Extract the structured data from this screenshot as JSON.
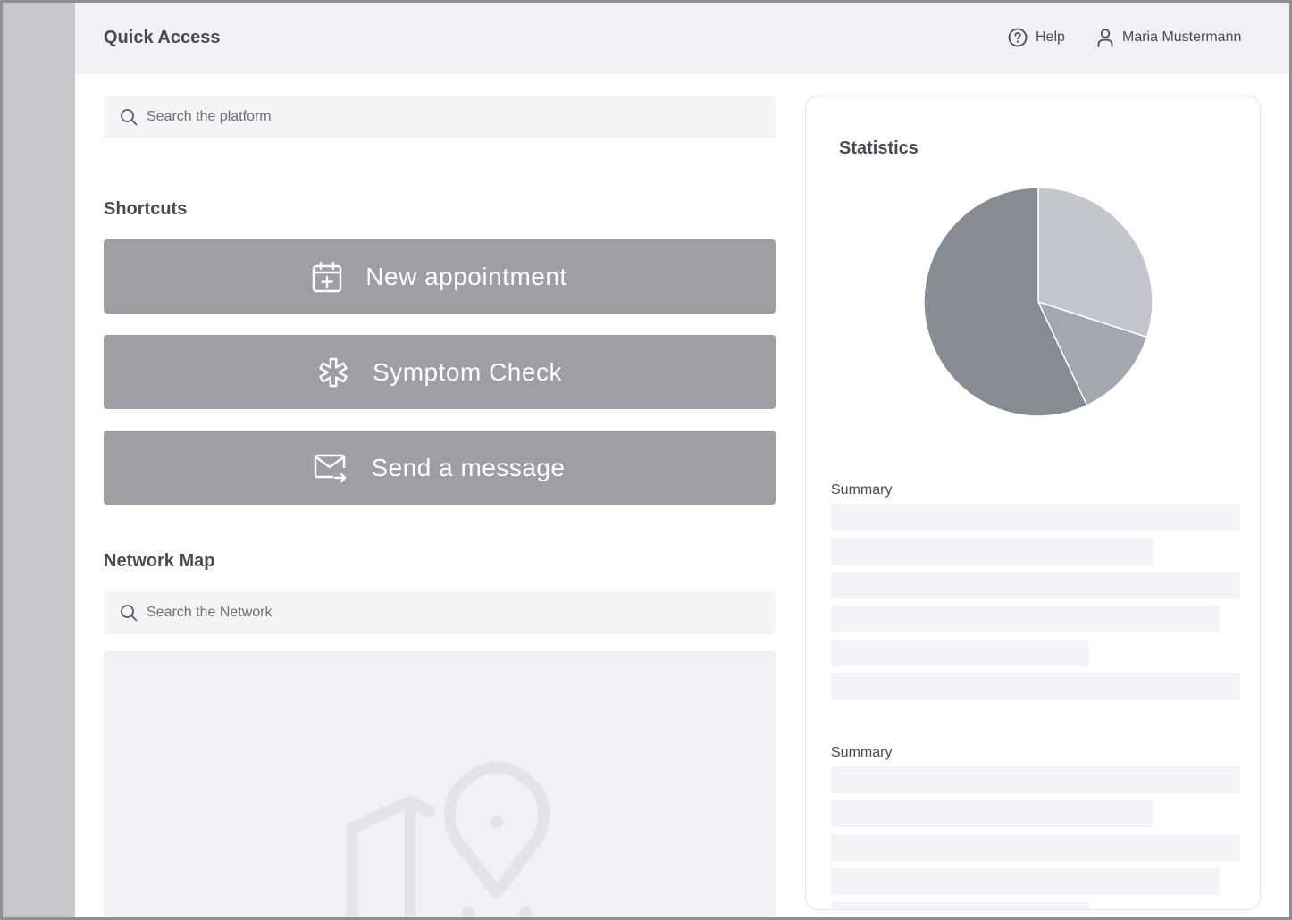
{
  "header": {
    "title": "Quick Access",
    "help_label": "Help",
    "user_name": "Maria Mustermann"
  },
  "search": {
    "placeholder": "Search the platform"
  },
  "shortcuts": {
    "title": "Shortcuts",
    "items": [
      {
        "label": "New appointment",
        "icon": "calendar-plus-icon"
      },
      {
        "label": "Symptom Check",
        "icon": "medical-asterisk-icon"
      },
      {
        "label": "Send a message",
        "icon": "mail-send-icon"
      }
    ]
  },
  "network": {
    "title": "Network Map",
    "search_placeholder": "Search the Network"
  },
  "statistics": {
    "title": "Statistics",
    "summaries": [
      {
        "label": "Summary"
      },
      {
        "label": "Summary"
      }
    ]
  },
  "chart_data": {
    "type": "pie",
    "values": [
      30,
      13,
      57
    ],
    "colors": [
      "#c3c6cc",
      "#a4a8ae",
      "#878c94"
    ]
  },
  "colors": {
    "sidebar": "#c8c8cc",
    "header_bg": "#f1f1f5",
    "button": "#9e9ea5",
    "text": "#4a4a50"
  }
}
